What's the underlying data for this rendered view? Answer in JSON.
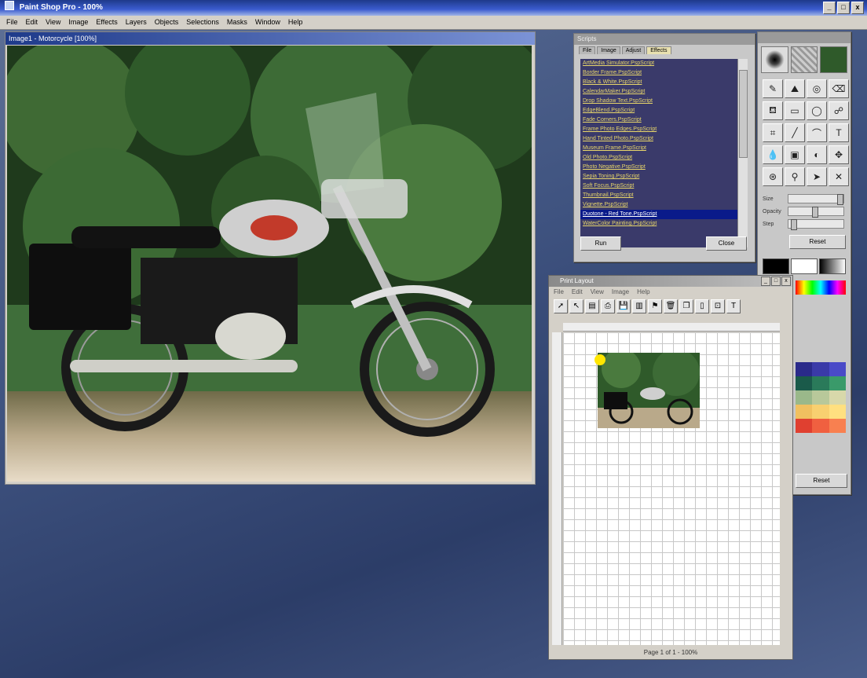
{
  "app": {
    "title": "Paint Shop Pro - 100%",
    "controls": [
      "_",
      "□",
      "x"
    ]
  },
  "menu": [
    "File",
    "Edit",
    "View",
    "Image",
    "Effects",
    "Layers",
    "Objects",
    "Selections",
    "Masks",
    "Window",
    "Help"
  ],
  "document": {
    "title": "Image1 - Motorcycle [100%]"
  },
  "script_panel": {
    "title": "Scripts",
    "tabs": [
      "File",
      "Image",
      "Adjust",
      "Effects"
    ],
    "items": [
      "ArtMedia Simulator.PspScript",
      "Border Frame.PspScript",
      "Black & White.PspScript",
      "CalendarMaker.PspScript",
      "Drop Shadow Text.PspScript",
      "EdgeBlend.PspScript",
      "Fade Corners.PspScript",
      "Frame Photo Edges.PspScript",
      "Hand Tinted Photo.PspScript",
      "Museum Frame.PspScript",
      "Old Photo.PspScript",
      "Photo Negative.PspScript",
      "Sepia Toning.PspScript",
      "Soft Focus.PspScript",
      "Thumbnail.PspScript",
      "Vignette.PspScript",
      "Duotone - Red Tone.PspScript",
      "WaterColor Painting.PspScript"
    ],
    "selected_index": 16,
    "left_button": "Run",
    "right_button": "Close"
  },
  "tools_panel": {
    "sliders": [
      {
        "label": "Size",
        "value": 0.88
      },
      {
        "label": "Opacity",
        "value": 0.45
      },
      {
        "label": "Step",
        "value": 0.05
      }
    ],
    "reset_label": "Reset",
    "bottom_reset_label": "Reset"
  },
  "preview": {
    "title": "Print Layout",
    "menu": [
      "File",
      "Edit",
      "View",
      "Image",
      "Help"
    ],
    "status": "Page 1 of 1 - 100%"
  },
  "colors": {
    "workspace": "#3f5380",
    "title_bar": "#1e3a8a",
    "script_item": "#e8d66a"
  }
}
